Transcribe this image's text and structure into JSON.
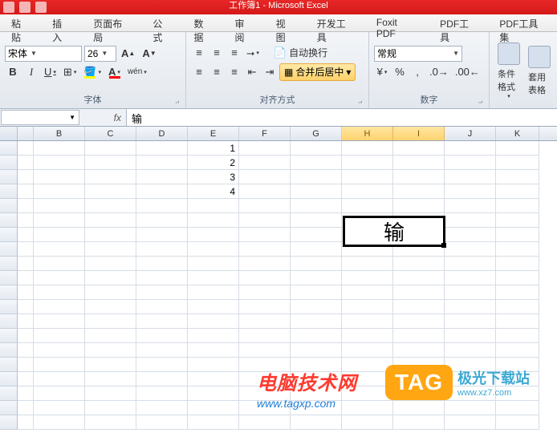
{
  "title": "工作簿1 - Microsoft Excel",
  "menu": [
    "粘贴",
    "插入",
    "页面布局",
    "公式",
    "数据",
    "审阅",
    "视图",
    "开发工具",
    "Foxit PDF",
    "PDF工具",
    "PDF工具集"
  ],
  "ribbon": {
    "font": {
      "label": "字体",
      "family": "宋体",
      "size": "26",
      "grow_icon": "A▲",
      "shrink_icon": "A▼",
      "bold": "B",
      "italic": "I",
      "underline": "U",
      "border_icon": "⊞",
      "fill_color": "#ffff00",
      "font_color": "#ff0000",
      "pinyin_icon": "wén"
    },
    "align": {
      "label": "对齐方式",
      "wrap_text": "自动换行",
      "merge_center": "合并后居中"
    },
    "number": {
      "label": "数字",
      "format": "常规",
      "currency_icon": "¥",
      "percent_icon": "%",
      "comma_icon": ",",
      "inc_dec": "⁰₀",
      "dec_dec": "₀⁰"
    },
    "styles": {
      "cond_format": "条件格式",
      "cell_styles": "套用表格"
    }
  },
  "fx": {
    "name_ref": "",
    "symbol": "fx",
    "value": "输"
  },
  "columns": [
    "B",
    "C",
    "D",
    "E",
    "F",
    "G",
    "H",
    "I",
    "J",
    "K"
  ],
  "selected_cols": [
    "H",
    "I"
  ],
  "e_values": [
    "1",
    "2",
    "3",
    "4"
  ],
  "selection_text": "输",
  "watermarks": {
    "w1_title": "电脑技术网",
    "w1_url": "www.tagxp.com",
    "w2_tag": "TAG",
    "w2_title": "极光下载站",
    "w2_url": "www.xz7.com"
  }
}
